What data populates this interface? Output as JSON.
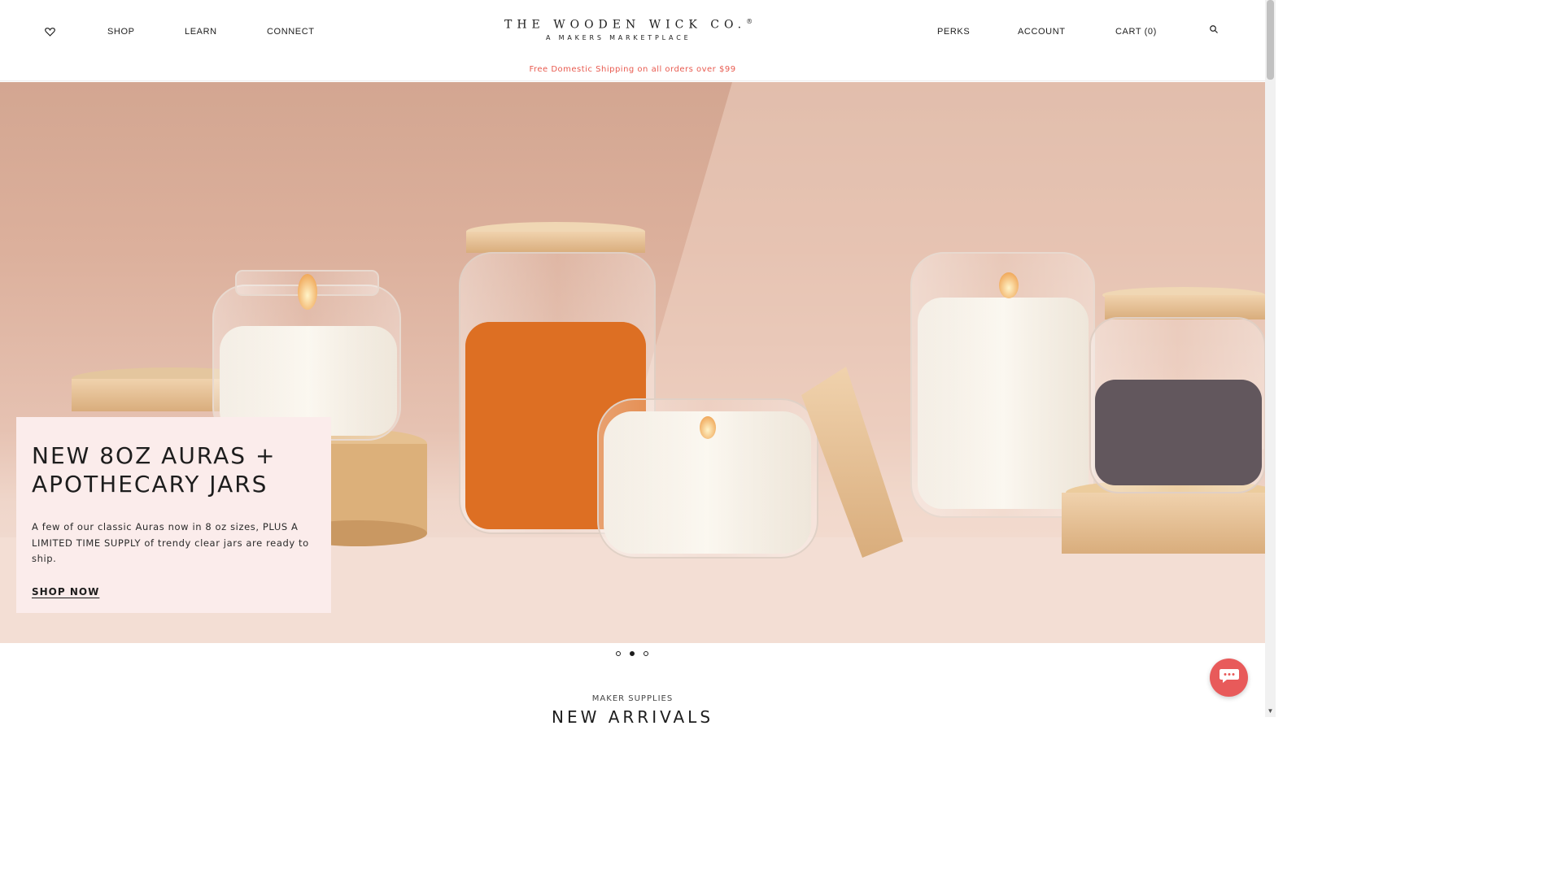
{
  "header": {
    "nav_left": [
      "SHOP",
      "LEARN",
      "CONNECT"
    ],
    "logo_line1": "THE WOODEN WICK CO.",
    "logo_reg": "®",
    "logo_line2": "A MAKERS MARKETPLACE",
    "nav_right": [
      "PERKS",
      "ACCOUNT",
      "CART (0)"
    ],
    "icons": [
      "heart-icon",
      "search-icon"
    ]
  },
  "promo": "Free Domestic Shipping on all orders over $99",
  "hero": {
    "title": "NEW 8OZ AURAS + APOTHECARY JARS",
    "body": "A few of our classic Auras now in 8 oz sizes, PLUS A LIMITED TIME SUPPLY of trendy clear jars are ready to ship.",
    "cta": "SHOP NOW",
    "slides": 3,
    "active_slide": 2
  },
  "section": {
    "eyebrow": "MAKER SUPPLIES",
    "title": "NEW ARRIVALS"
  },
  "colors": {
    "accent": "#e85a4f",
    "hero_card": "#fbeceb",
    "chat_button": "#e85a5a"
  }
}
